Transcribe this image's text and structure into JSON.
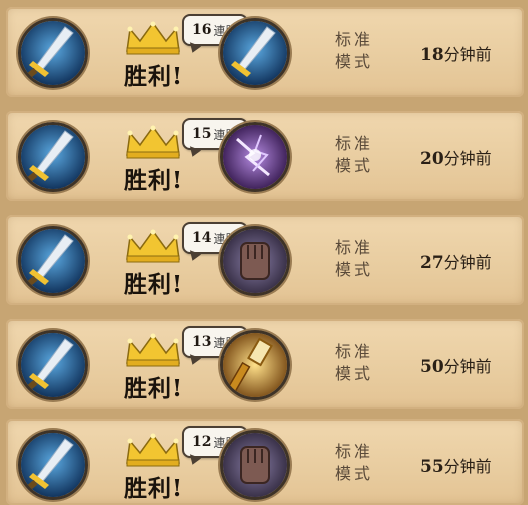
{
  "victory_label": "胜利!",
  "streak_suffix": "連胜",
  "mode_line1": "标准",
  "mode_line2": "模式",
  "time_suffix": "分钟前",
  "matches": [
    {
      "streak": "16",
      "minutes": "18",
      "opponent_hero_icon": "sword-icon"
    },
    {
      "streak": "15",
      "minutes": "20",
      "opponent_hero_icon": "lightning-icon"
    },
    {
      "streak": "14",
      "minutes": "27",
      "opponent_hero_icon": "fist-icon"
    },
    {
      "streak": "13",
      "minutes": "50",
      "opponent_hero_icon": "golden-hammer-icon"
    },
    {
      "streak": "12",
      "minutes": "55",
      "opponent_hero_icon": "fist-icon"
    }
  ],
  "colors": {
    "panel_background": "#e8cc9f",
    "frame_background": "#c7a573",
    "crown_gold": "#f2c531",
    "text_dark": "#1a130c"
  }
}
